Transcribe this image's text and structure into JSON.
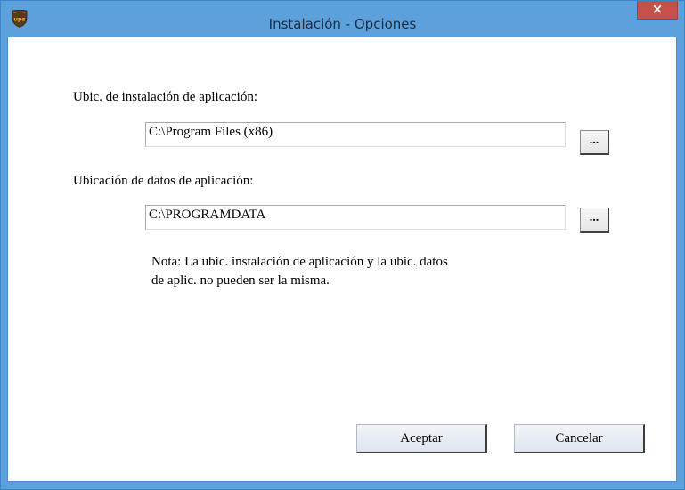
{
  "window": {
    "title": "Instalación - Opciones",
    "close_label": "×",
    "app_icon": "ups-shield-icon"
  },
  "form": {
    "app_location_label": "Ubic. de instalación de aplicación:",
    "app_location_value": "C:\\Program Files (x86)",
    "data_location_label": "Ubicación de datos de aplicación:",
    "data_location_value": "C:\\PROGRAMDATA",
    "browse_label": "...",
    "note_line1": "Nota: La ubic. instalación de aplicación y la ubic. datos",
    "note_line2": "de aplic. no pueden ser la misma."
  },
  "buttons": {
    "accept": "Aceptar",
    "cancel": "Cancelar"
  },
  "colors": {
    "titlebar": "#5ca0dc",
    "close": "#c7504a",
    "ups_brown": "#5a3a1e",
    "ups_gold": "#f0b42a"
  }
}
